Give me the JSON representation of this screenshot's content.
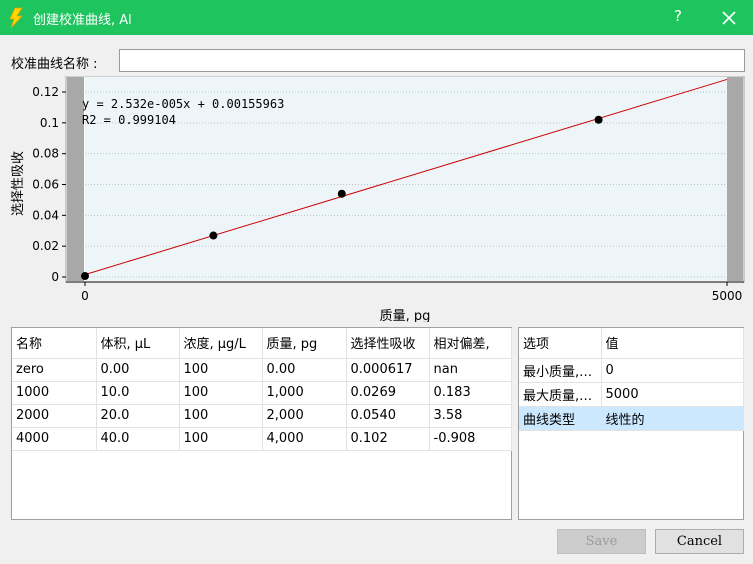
{
  "window": {
    "title": "创建校准曲线, Al",
    "help_label": "?",
    "accent_color": "#1ec55f"
  },
  "form": {
    "name_label": "校准曲线名称 :",
    "name_value": "",
    "name_placeholder": ""
  },
  "chart_data": {
    "type": "scatter",
    "xlabel": "质量, pg",
    "ylabel": "选择性吸收",
    "xlim": [
      0,
      5000
    ],
    "ylim": [
      0,
      0.12
    ],
    "x_ticks": [
      0,
      5000
    ],
    "y_ticks": [
      0,
      0.02,
      0.04,
      0.06,
      0.08,
      0.1,
      0.12
    ],
    "points": [
      {
        "x": 0,
        "y": 0.000617
      },
      {
        "x": 1000,
        "y": 0.0269
      },
      {
        "x": 2000,
        "y": 0.054
      },
      {
        "x": 4000,
        "y": 0.102
      }
    ],
    "fit": {
      "slope": 2.532e-05,
      "intercept": 0.00155963
    },
    "annotations": [
      "y = 2.532e-005x + 0.00155963",
      "R2 = 0.999104"
    ],
    "grid": true,
    "plot_background": "#eef5f8",
    "fit_color": "#cc0000",
    "point_color": "#000000"
  },
  "data_table": {
    "columns": [
      "名称",
      "体积, μL",
      "浓度, μg/L",
      "质量, pg",
      "选择性吸收",
      "相对偏差,"
    ],
    "rows": [
      [
        "zero",
        "0.00",
        "100",
        "0.00",
        "0.000617",
        "nan"
      ],
      [
        "1000",
        "10.0",
        "100",
        "1,000",
        "0.0269",
        "0.183"
      ],
      [
        "2000",
        "20.0",
        "100",
        "2,000",
        "0.0540",
        "3.58"
      ],
      [
        "4000",
        "40.0",
        "100",
        "4,000",
        "0.102",
        "-0.908"
      ]
    ]
  },
  "options_table": {
    "columns": [
      "选项",
      "值"
    ],
    "rows": [
      [
        "最小质量,…",
        "0"
      ],
      [
        "最大质量,…",
        "5000"
      ],
      [
        "曲线类型",
        "线性的"
      ]
    ],
    "selected_index": 2
  },
  "buttons": {
    "save_label": "Save",
    "cancel_label": "Cancel"
  }
}
